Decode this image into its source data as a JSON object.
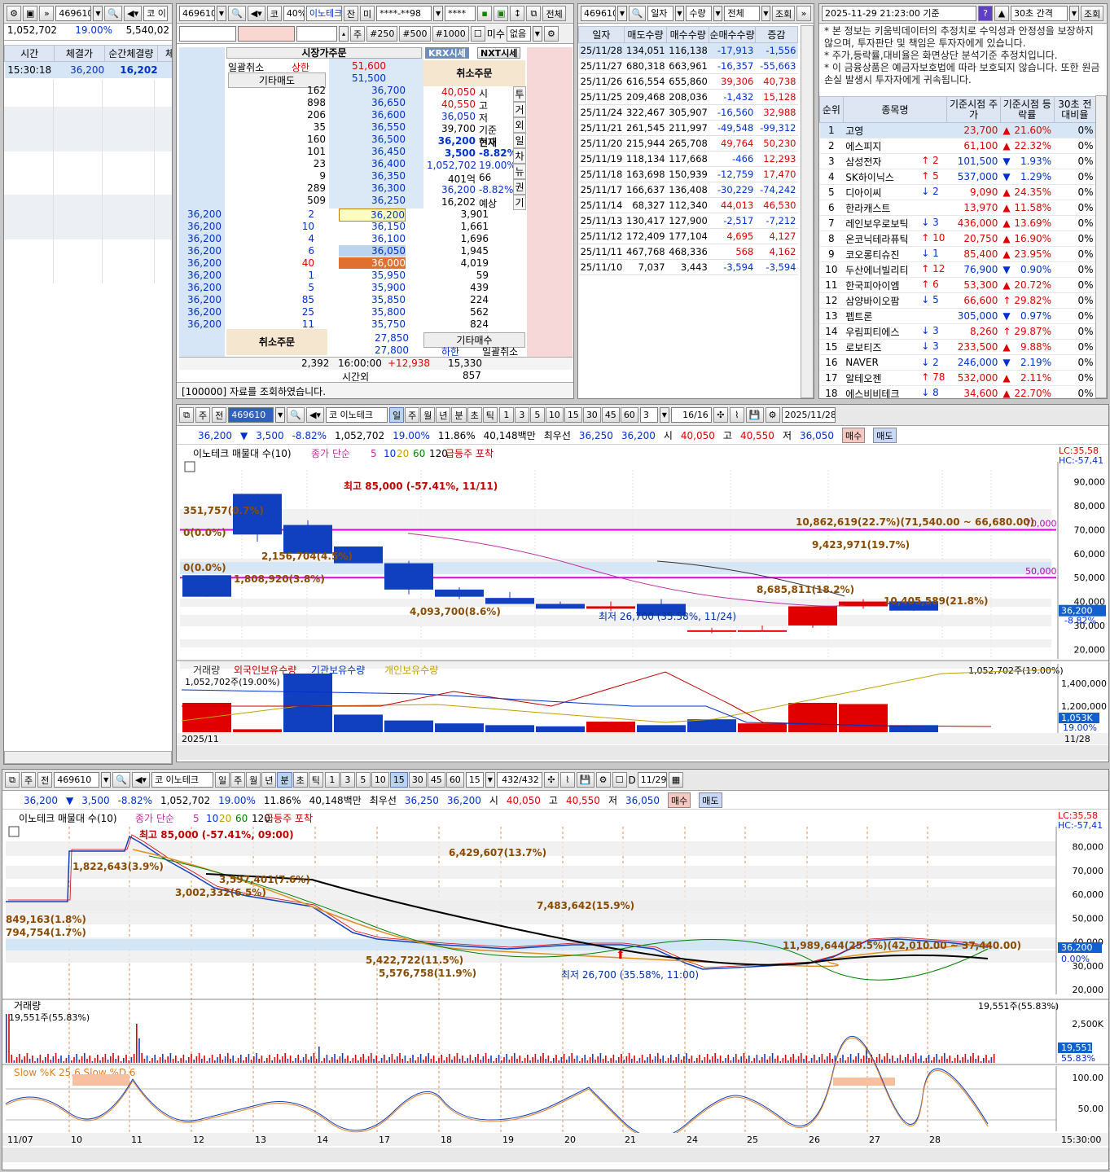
{
  "p1": {
    "code": "469610",
    "name_short": "코 이",
    "vals": [
      "1,052,702",
      "19.00%",
      "5,540,02"
    ],
    "cols": [
      "시간",
      "체결가",
      "순간체결량",
      "체결"
    ],
    "row": {
      "time": "15:30:18",
      "price": "36,200",
      "qty": "16,202"
    }
  },
  "p2": {
    "code": "469610",
    "pct": "40%",
    "name": "이노테크",
    "b_jan": "잔",
    "b_mi": "미",
    "acct": "****-**98",
    "pw": "****",
    "btn_all": "전체",
    "row2": {
      "ju": "주",
      "q1": "#250",
      "q2": "#500",
      "q3": "#1000",
      "misu": "미수",
      "none": "없음"
    },
    "market_order": "시장가주문",
    "krx": "KRX시세",
    "nxt": "NXT시세",
    "cancel_all": "일괄취소",
    "upper": "상한",
    "upper_v": "51,600",
    "other_sell": "기타매도",
    "other_sell_v": "51,500",
    "cancel_order": "취소주문",
    "asks": [
      [
        "162",
        "36,700"
      ],
      [
        "898",
        "36,650"
      ],
      [
        "206",
        "36,600"
      ],
      [
        "35",
        "36,550"
      ],
      [
        "160",
        "36,500"
      ],
      [
        "101",
        "36,450"
      ],
      [
        "23",
        "36,400"
      ],
      [
        "9",
        "36,350"
      ],
      [
        "289",
        "36,300"
      ],
      [
        "509",
        "36,250"
      ]
    ],
    "info": [
      [
        "40,050",
        "시"
      ],
      [
        "40,550",
        "고"
      ],
      [
        "36,050",
        "저"
      ],
      [
        "39,700",
        "기준"
      ],
      [
        "36,200",
        "현재"
      ],
      [
        "3,500",
        "-8.82%"
      ],
      [
        "1,052,702",
        "19.00%"
      ],
      [
        "401억",
        "66"
      ],
      [
        "36,200",
        "-8.82%"
      ],
      [
        "16,202",
        "예상"
      ]
    ],
    "side_tabs": [
      "투",
      "거",
      "외",
      "일",
      "차",
      "뉴",
      "권",
      "기"
    ],
    "bid_left": [
      [
        "36,200",
        "2"
      ],
      [
        "36,200",
        "10"
      ],
      [
        "36,200",
        "4"
      ],
      [
        "36,200",
        "6"
      ],
      [
        "36,200",
        "40"
      ],
      [
        "36,200",
        "1"
      ],
      [
        "36,200",
        "5"
      ],
      [
        "36,200",
        "85"
      ],
      [
        "36,200",
        "25"
      ],
      [
        "36,200",
        "11"
      ]
    ],
    "bids": [
      [
        "36,200",
        "3,901"
      ],
      [
        "36,150",
        "1,661"
      ],
      [
        "36,100",
        "1,696"
      ],
      [
        "36,050",
        "1,945"
      ],
      [
        "36,000",
        "4,019"
      ],
      [
        "35,950",
        "59"
      ],
      [
        "35,900",
        "439"
      ],
      [
        "35,850",
        "224"
      ],
      [
        "35,800",
        "562"
      ],
      [
        "35,750",
        "824"
      ]
    ],
    "other_buy": "기타매수",
    "low_v": "27,850",
    "other_buy_v": "27,800",
    "lower": "하한",
    "cancel_all2": "일괄취소",
    "tot": {
      "ask": "2,392",
      "time": "16:00:00",
      "diff": "+12,938",
      "bid": "15,330"
    },
    "after": {
      "label": "시간외",
      "v": "857"
    },
    "status": "[100000] 자료를 조회하였습니다."
  },
  "p3": {
    "code": "469610",
    "f1": "일자",
    "f2": "수량",
    "f3": "전체",
    "btn": "조회",
    "cols": [
      "일자",
      "매도수량",
      "매수수량",
      "순매수수량",
      "증감"
    ],
    "rows": [
      [
        "25/11/28",
        "134,051",
        "116,138",
        "-17,913",
        "-1,556"
      ],
      [
        "25/11/27",
        "680,318",
        "663,961",
        "-16,357",
        "-55,663"
      ],
      [
        "25/11/26",
        "616,554",
        "655,860",
        "39,306",
        "40,738"
      ],
      [
        "25/11/25",
        "209,468",
        "208,036",
        "-1,432",
        "15,128"
      ],
      [
        "25/11/24",
        "322,467",
        "305,907",
        "-16,560",
        "32,988"
      ],
      [
        "25/11/21",
        "261,545",
        "211,997",
        "-49,548",
        "-99,312"
      ],
      [
        "25/11/20",
        "215,944",
        "265,708",
        "49,764",
        "50,230"
      ],
      [
        "25/11/19",
        "118,134",
        "117,668",
        "-466",
        "12,293"
      ],
      [
        "25/11/18",
        "163,698",
        "150,939",
        "-12,759",
        "17,470"
      ],
      [
        "25/11/17",
        "166,637",
        "136,408",
        "-30,229",
        "-74,242"
      ],
      [
        "25/11/14",
        "68,327",
        "112,340",
        "44,013",
        "46,530"
      ],
      [
        "25/11/13",
        "130,417",
        "127,900",
        "-2,517",
        "-7,212"
      ],
      [
        "25/11/12",
        "172,409",
        "177,104",
        "4,695",
        "4,127"
      ],
      [
        "25/11/11",
        "467,768",
        "468,336",
        "568",
        "4,162"
      ],
      [
        "25/11/10",
        "7,037",
        "3,443",
        "-3,594",
        "-3,594"
      ]
    ]
  },
  "p4": {
    "dt": "2025-11-29 21:23:00 기준",
    "interval": "30초 간격",
    "btn": "조회",
    "notice": [
      "* 본 정보는 키움빅데이터의 추정치로 수익성과 안정성을 보장하지 않으며, 투자판단 및 책임은 투자자에게 있습니다.",
      "* 주가,등락률,대비율은 화면상단 분석기준 추정치입니다.",
      "* 이 금융상품은 예금자보호법에 따라 보호되지 않습니다. 또한 원금손실 발생시 투자자에게 귀속됩니다."
    ],
    "cols": [
      "순위",
      "종목명",
      "기준시점 주가",
      "기준시점 등락률",
      "30초 전 대비율"
    ],
    "rows": [
      [
        "1",
        "고영",
        "",
        "",
        "23,700",
        "▲",
        "21.60%",
        "0%"
      ],
      [
        "2",
        "에스피지",
        "",
        "",
        "61,100",
        "▲",
        "22.32%",
        "0%"
      ],
      [
        "3",
        "삼성전자",
        "↑",
        "2",
        "101,500",
        "▼",
        "1.93%",
        "0%"
      ],
      [
        "4",
        "SK하이닉스",
        "↑",
        "5",
        "537,000",
        "▼",
        "1.29%",
        "0%"
      ],
      [
        "5",
        "디아이씨",
        "↓",
        "2",
        "9,090",
        "▲",
        "24.35%",
        "0%"
      ],
      [
        "6",
        "한라캐스트",
        "",
        "",
        "13,970",
        "▲",
        "11.58%",
        "0%"
      ],
      [
        "7",
        "레인보우로보틱",
        "↓",
        "3",
        "436,000",
        "▲",
        "13.69%",
        "0%"
      ],
      [
        "8",
        "온코닉테라퓨틱",
        "↑",
        "10",
        "20,750",
        "▲",
        "16.90%",
        "0%"
      ],
      [
        "9",
        "코오롱티슈진",
        "↓",
        "1",
        "85,400",
        "▲",
        "23.95%",
        "0%"
      ],
      [
        "10",
        "두산에너빌리티",
        "↑",
        "12",
        "76,900",
        "▼",
        "0.90%",
        "0%"
      ],
      [
        "11",
        "한국피아이엠",
        "↑",
        "6",
        "53,300",
        "▲",
        "20.72%",
        "0%"
      ],
      [
        "12",
        "삼양바이오팜",
        "↓",
        "5",
        "66,600",
        "↑",
        "29.82%",
        "0%"
      ],
      [
        "13",
        "펩트론",
        "",
        "",
        "305,000",
        "▼",
        "0.97%",
        "0%"
      ],
      [
        "14",
        "우림피티에스",
        "↓",
        "3",
        "8,260",
        "↑",
        "29.87%",
        "0%"
      ],
      [
        "15",
        "로보티즈",
        "↓",
        "3",
        "233,500",
        "▲",
        "9.88%",
        "0%"
      ],
      [
        "16",
        "NAVER",
        "↓",
        "2",
        "246,000",
        "▼",
        "2.19%",
        "0%"
      ],
      [
        "17",
        "알테오젠",
        "↑",
        "78",
        "532,000",
        "▲",
        "2.11%",
        "0%"
      ],
      [
        "18",
        "에스비비테크",
        "↓",
        "8",
        "34,600",
        "▲",
        "22.70%",
        "0%"
      ]
    ]
  },
  "c1": {
    "toolbar": {
      "ju": "주",
      "jeon": "전",
      "code": "469610",
      "name": "코 이노테크",
      "periods": [
        "일",
        "주",
        "월",
        "년",
        "분",
        "초",
        "틱"
      ],
      "nums": [
        "1",
        "3",
        "5",
        "10",
        "15",
        "30",
        "45",
        "60"
      ],
      "sel": "3",
      "page": "16/16",
      "date": "2025/11/28"
    },
    "quote": {
      "price": "36,200",
      "diff": "3,500",
      "pct": "-8.82%",
      "vol": "1,052,702",
      "turn": "19.00%",
      "r": "11.86%",
      "amt": "40,148백만",
      "best_lbl": "최우선",
      "ask": "36,250",
      "bid": "36,200",
      "o_lbl": "시",
      "o": "40,050",
      "h_lbl": "고",
      "h": "40,550",
      "l_lbl": "저",
      "l": "36,050",
      "buy": "매수",
      "sell": "매도"
    },
    "legend": {
      "a": "이노테크 매물대 수(10)",
      "b": "종가 단순",
      "n": [
        "5",
        "10",
        "20",
        "60",
        "120"
      ],
      "c": "급등주 포착"
    },
    "lc": "LC:35,58",
    "hc": "HC:-57,41",
    "yticks": [
      "90,000",
      "80,000",
      "70,000",
      "60,000",
      "50,000",
      "40,000",
      "30,000",
      "20,000"
    ],
    "cur_price": "36,200",
    "cur_pct": "-8.82%",
    "line70": "70,000",
    "line50": "50,000",
    "labels": {
      "high": "최고 85,000 (-57.41%, 11/11)",
      "low": "최저 26,700 (35.58%, 11/24)",
      "v1": "351,757(0.7%)",
      "v2": "0(0.0%)",
      "v3": "2,156,704(4.5%)",
      "v4": "0(0.0%)",
      "v5": "1,808,920(3.8%)",
      "v6": "4,093,700(8.6%)",
      "v7": "10,862,619(22.7%)(71,540.00 ~ 66,680.00)",
      "v8": "9,423,971(19.7%)",
      "v9": "8,685,811(18.2%)",
      "v10": "10,405,589(21.8%)"
    },
    "vol_legend": [
      "거래량",
      "외국인보유수량",
      "기관보유수량",
      "개인보유수량"
    ],
    "vol_left": "1,052,702주(19.00%)",
    "vol_right": "1,052,702주(19.00%)",
    "vol_ticks": [
      "1,400,000",
      "1,200,000"
    ],
    "vol_cur": "1,053K",
    "vol_cur_pct": "19.00%",
    "x_left": "2025/11",
    "x_right": "11/28"
  },
  "c2": {
    "toolbar": {
      "ju": "주",
      "jeon": "전",
      "code": "469610",
      "name": "코 이노테크",
      "periods": [
        "일",
        "주",
        "월",
        "년",
        "분",
        "초",
        "틱"
      ],
      "nums": [
        "1",
        "3",
        "5",
        "10",
        "15",
        "30",
        "45",
        "60"
      ],
      "sel": "15",
      "page": "432/432",
      "date": "11/29",
      "d_lbl": "D"
    },
    "quote": {
      "price": "36,200",
      "diff": "3,500",
      "pct": "-8.82%",
      "vol": "1,052,702",
      "turn": "19.00%",
      "r": "11.86%",
      "amt": "40,148백만",
      "best_lbl": "최우선",
      "ask": "36,250",
      "bid": "36,200",
      "o_lbl": "시",
      "o": "40,050",
      "h_lbl": "고",
      "h": "40,550",
      "l_lbl": "저",
      "l": "36,050",
      "buy": "매수",
      "sell": "매도"
    },
    "legend": {
      "a": "이노테크 매물대 수(10)",
      "b": "종가 단순",
      "n": [
        "5",
        "10",
        "20",
        "60",
        "120"
      ],
      "c": "급등주 포착"
    },
    "lc": "LC:35,58",
    "hc": "HC:-57,41",
    "yticks": [
      "80,000",
      "70,000",
      "60,000",
      "50,000",
      "40,000",
      "30,000",
      "20,000"
    ],
    "cur_price": "36,200",
    "cur_pct": "0.00%",
    "labels": {
      "high": "최고 85,000 (-57.41%, 09:00)",
      "low": "최저 26,700 (35.58%, 11:00)",
      "v1": "1,822,643(3.9%)",
      "v2": "6,429,607(13.7%)",
      "v3": "3,597,401(7.6%)",
      "v4": "3,002,332(6.5%)",
      "v5": "849,163(1.8%)",
      "v6": "794,754(1.7%)",
      "v7": "7,483,642(15.9%)",
      "v8": "11,989,644(25.5%)(42,010.00 ~ 37,440.00)",
      "v9": "5,422,722(11.5%)",
      "v10": "5,576,758(11.9%)"
    },
    "vol_lbl": "거래량",
    "vol_left": "19,551주(55.83%)",
    "vol_right": "19,551주(55.83%)",
    "vol_tick": "2,500K",
    "vol_cur": "19,551",
    "vol_cur_pct": "55.83%",
    "stoch": "Slow %K 25.6  Slow %D 6",
    "stoch_ticks": [
      "100.00",
      "50.00"
    ],
    "xticks": [
      "11/07",
      "10",
      "11",
      "12",
      "13",
      "14",
      "17",
      "18",
      "19",
      "20",
      "21",
      "24",
      "25",
      "26",
      "27",
      "28"
    ],
    "x_time": "15:30:00"
  }
}
